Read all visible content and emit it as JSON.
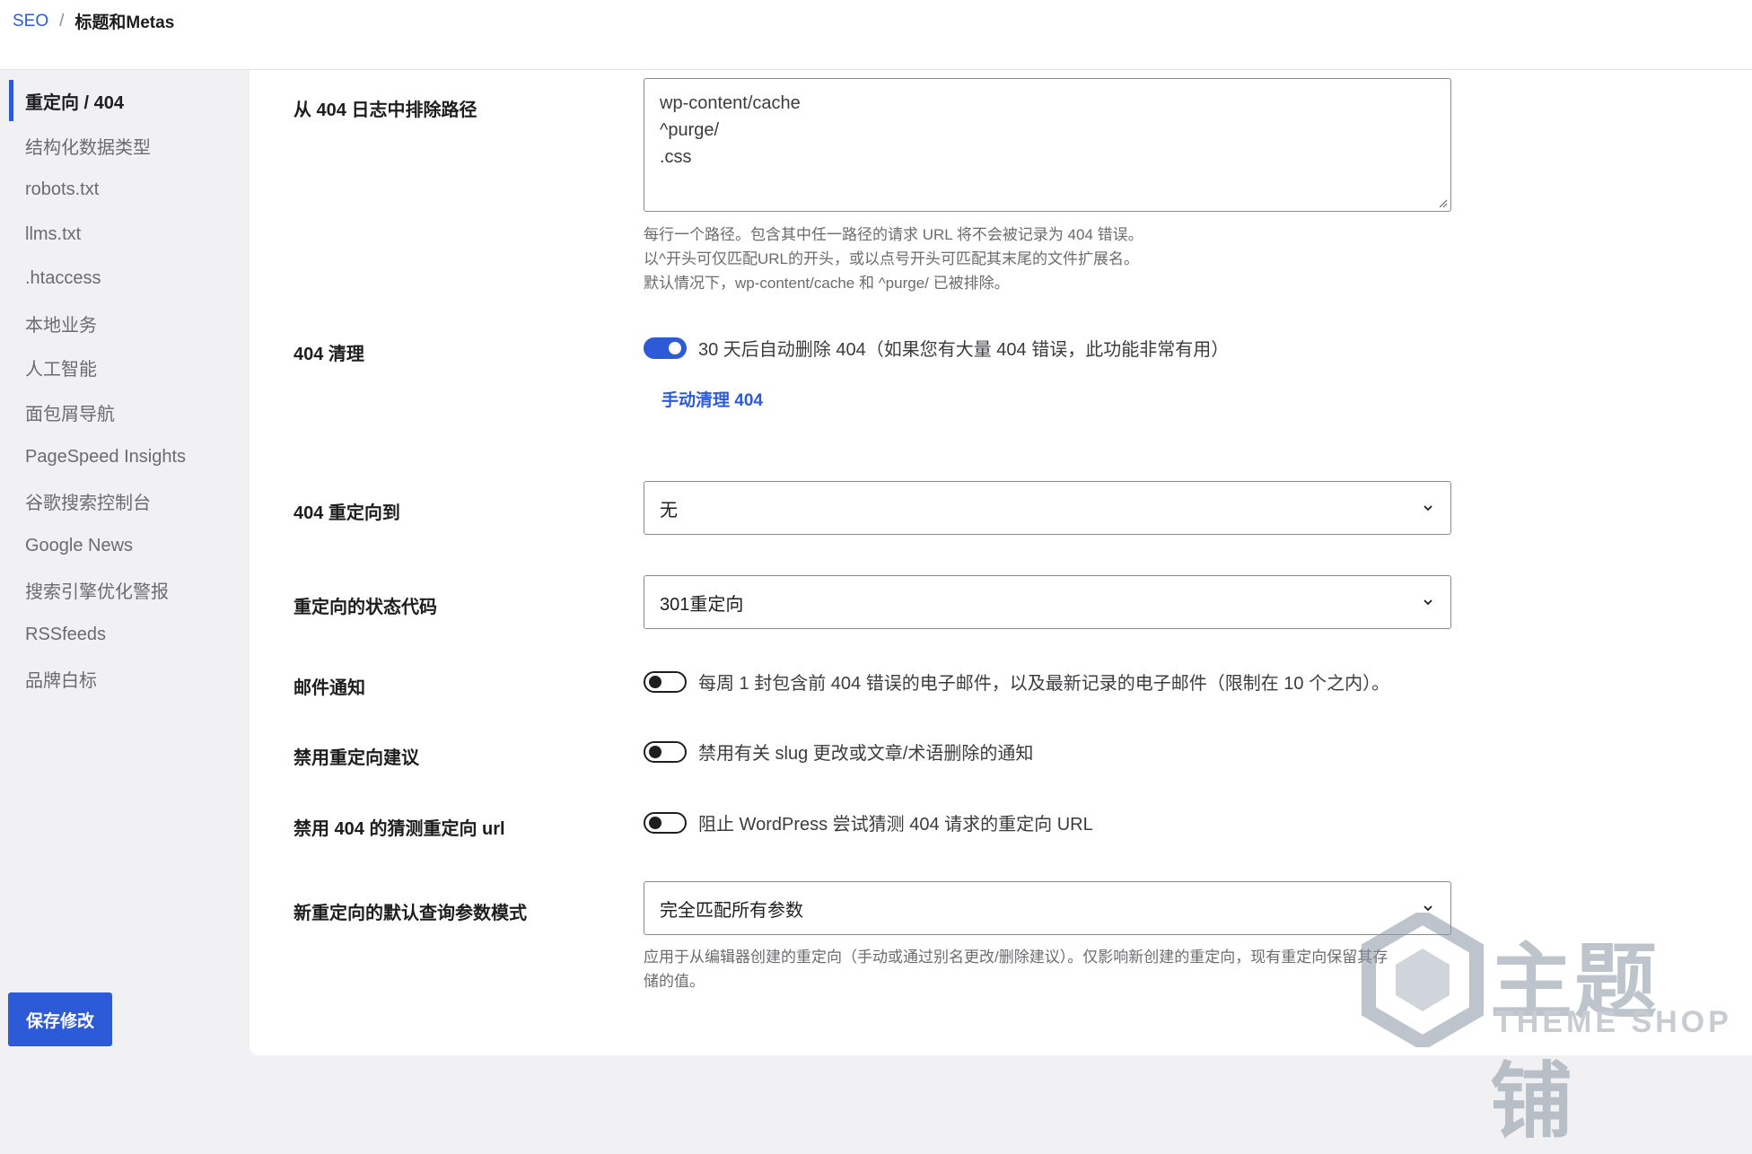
{
  "breadcrumb": {
    "root": "SEO",
    "separator": "/",
    "current": "标题和Metas"
  },
  "sidebar": {
    "items": [
      {
        "label": "重定向 / 404",
        "active": true
      },
      {
        "label": "结构化数据类型"
      },
      {
        "label": "robots.txt"
      },
      {
        "label": "llms.txt"
      },
      {
        "label": ".htaccess"
      },
      {
        "label": "本地业务"
      },
      {
        "label": "人工智能"
      },
      {
        "label": "面包屑导航"
      },
      {
        "label": "PageSpeed Insights"
      },
      {
        "label": "谷歌搜索控制台"
      },
      {
        "label": "Google News"
      },
      {
        "label": "搜索引擎优化警报"
      },
      {
        "label": "RSSfeeds"
      },
      {
        "label": "品牌白标"
      }
    ],
    "save_label": "保存修改"
  },
  "settings": {
    "exclude_paths": {
      "label": "从 404 日志中排除路径",
      "value": "wp-content/cache\n^purge/\n.css",
      "help": [
        "每行一个路径。包含其中任一路径的请求 URL 将不会被记录为 404 错误。",
        "以^开头可仅匹配URL的开头，或以点号开头可匹配其末尾的文件扩展名。",
        "默认情况下，wp-content/cache 和 ^purge/ 已被排除。"
      ]
    },
    "cleanup": {
      "label": "404 清理",
      "toggle_text": "30 天后自动删除 404（如果您有大量 404 错误，此功能非常有用）",
      "enabled": true,
      "manual_link": "手动清理 404"
    },
    "redirect_to": {
      "label": "404 重定向到",
      "value": "无"
    },
    "status_code": {
      "label": "重定向的状态代码",
      "value": "301重定向"
    },
    "email": {
      "label": "邮件通知",
      "toggle_text": "每周 1 封包含前 404 错误的电子邮件，以及最新记录的电子邮件（限制在 10 个之内）。",
      "enabled": false
    },
    "disable_suggestions": {
      "label": "禁用重定向建议",
      "toggle_text": "禁用有关 slug 更改或文章/术语删除的通知",
      "enabled": false
    },
    "disable_guess": {
      "label": "禁用 404 的猜测重定向 url",
      "toggle_text": "阻止 WordPress 尝试猜测 404 请求的重定向 URL",
      "enabled": false
    },
    "query_mode": {
      "label": "新重定向的默认查询参数模式",
      "value": "完全匹配所有参数",
      "help": [
        "应用于从编辑器创建的重定向（手动或通过别名更改/删除建议）。仅影响新创建的重定向，现有重定向保留其存",
        "储的值。"
      ]
    }
  },
  "watermark": {
    "cn": "主题铺",
    "en": "THEME SHOP"
  },
  "colors": {
    "accent": "#2d5bd7",
    "text": "#1e1e1e",
    "muted": "#6b6b70",
    "background": "#f1f1f3"
  }
}
